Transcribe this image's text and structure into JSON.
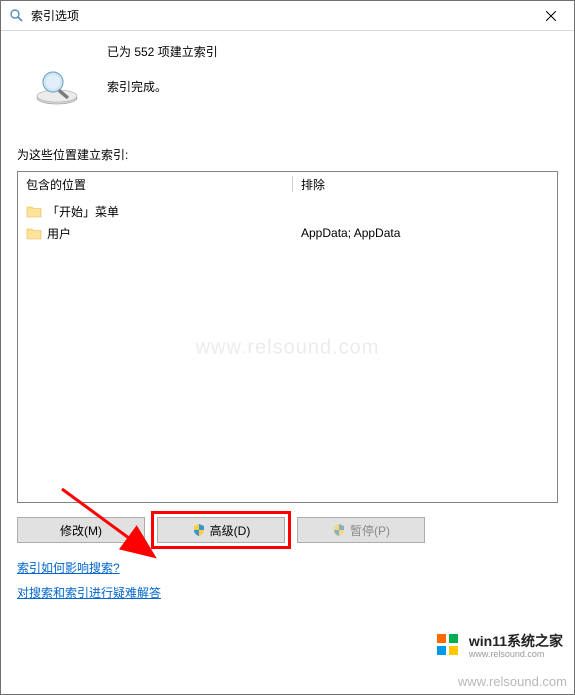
{
  "titlebar": {
    "title": "索引选项"
  },
  "status": {
    "line1": "已为 552 项建立索引",
    "line2": "索引完成。"
  },
  "section_label": "为这些位置建立索引:",
  "columns": {
    "included": "包含的位置",
    "excluded": "排除"
  },
  "included_items": [
    {
      "label": "「开始」菜单"
    },
    {
      "label": "用户"
    }
  ],
  "excluded_items": [
    {
      "label": ""
    },
    {
      "label": "AppData; AppData"
    }
  ],
  "buttons": {
    "modify": "修改(M)",
    "advanced": "高级(D)",
    "pause": "暂停(P)"
  },
  "links": {
    "help1": "索引如何影响搜索?",
    "help2": "对搜索和索引进行疑难解答"
  },
  "logo": {
    "text": "win11系统之家",
    "sub": "www.relsound.com"
  },
  "watermark": "www.relsound.com"
}
